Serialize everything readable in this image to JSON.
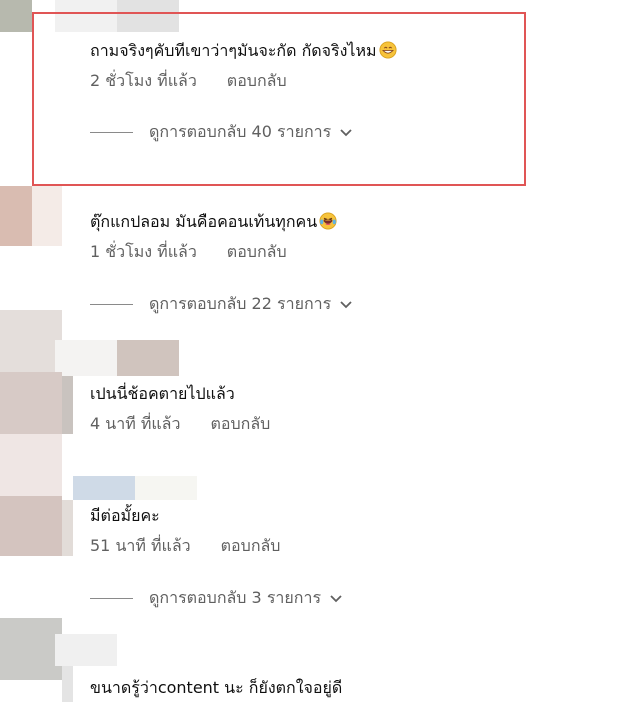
{
  "comments": [
    {
      "text": "ถามจริงๆคับทีเขาว่าๆมันจะกัด กัดจริงไหม",
      "time": "2 ชั่วโมง ที่แล้ว",
      "reply_label": "ตอบกลับ",
      "view_replies": "ดูการตอบกลับ 40 รายการ",
      "emoji": "grinning-face-icon"
    },
    {
      "text": "ตุ๊กแกปลอม มันคือคอนเท้นทุกคน",
      "time": "1 ชั่วโมง ที่แล้ว",
      "reply_label": "ตอบกลับ",
      "view_replies": "ดูการตอบกลับ 22 รายการ",
      "emoji": "laughing-face-icon"
    },
    {
      "text": "เปนนี่ช้อคตายไปแล้ว",
      "time": "4 นาที ที่แล้ว",
      "reply_label": "ตอบกลับ"
    },
    {
      "text": "มีต่อมั้ยคะ",
      "time": "51 นาที ที่แล้ว",
      "reply_label": "ตอบกลับ",
      "view_replies": "ดูการตอบกลับ 3 รายการ"
    },
    {
      "text": "ขนาดรู้ว่าcontent นะ ก็ยังตกใจอยู่ดี"
    }
  ],
  "colors": {
    "highlight": "#e05555",
    "text": "#0f0f0f",
    "secondary_text": "#606060"
  }
}
